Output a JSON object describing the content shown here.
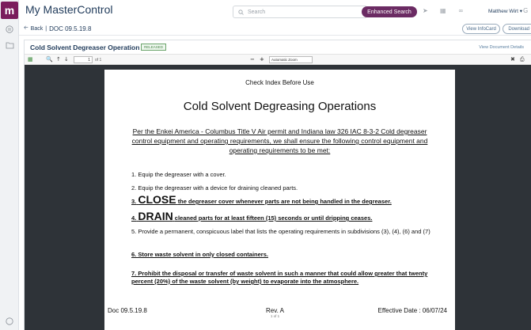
{
  "app": {
    "title": "My MasterControl",
    "logo_text": "m"
  },
  "header": {
    "search_placeholder": "Search",
    "enhanced_search_label": "Enhanced Search",
    "user_name": "Matthew Wirt ▾"
  },
  "subbar": {
    "back_label": "Back",
    "separator": "|",
    "doc_number": "DOC 09.5.19.8",
    "view_infocard_label": "View InfoCard",
    "download_label": "Download ▾"
  },
  "doc_header": {
    "title": "Cold Solvent Degreaser Operation",
    "status_badge": "RELEASED",
    "view_details_label": "View Document Details"
  },
  "pdf_toolbar": {
    "page_value": "1",
    "of_pages": "of 1",
    "zoom_label": "Automatic Zoom"
  },
  "page": {
    "top_note": "Check Index Before Use",
    "title": "Cold Solvent Degreasing Operations",
    "intro": "Per the Enkei America - Columbus Title V Air permit and Indiana law 326 IAC 8-3-2 Cold degreaser control equipment and operating requirements, we shall ensure the following control equipment and operating requirements to be met:",
    "item1": "1. Equip the degreaser with a cover.",
    "item2": "2. Equip the degreaser with a device for draining cleaned parts.",
    "item3_num": "3.",
    "item3_big": "CLOSE",
    "item3_rest": "the degreaser cover whenever parts are not being handled in the degreaser.",
    "item4_num": "4.",
    "item4_big": "DRAIN",
    "item4_rest": "cleaned parts for at least fifteen (15) seconds or until dripping ceases.",
    "item5": "5. Provide a permanent, conspicuous label that lists the operating requirements in subdivisions (3), (4), (6) and (7)",
    "item6": "6. Store waste solvent in only closed containers.",
    "item7": "7. Prohibit the disposal or transfer of waste solvent in such a manner that could allow greater that twenty percent (20%) of the waste solvent (by weight) to evaporate into the atmosphere.",
    "footer_doc": "Doc 09.5.19.8",
    "footer_rev": "Rev. A",
    "footer_rev_sub": "1 of 1",
    "footer_effective": "Effective Date : 06/07/24"
  },
  "colors": {
    "brand": "#7a1c5c",
    "enhanced_search": "#6b2b63",
    "title_navy": "#1f3a5a",
    "released_green": "#4a874a",
    "viewer_bg": "#2e3338"
  }
}
